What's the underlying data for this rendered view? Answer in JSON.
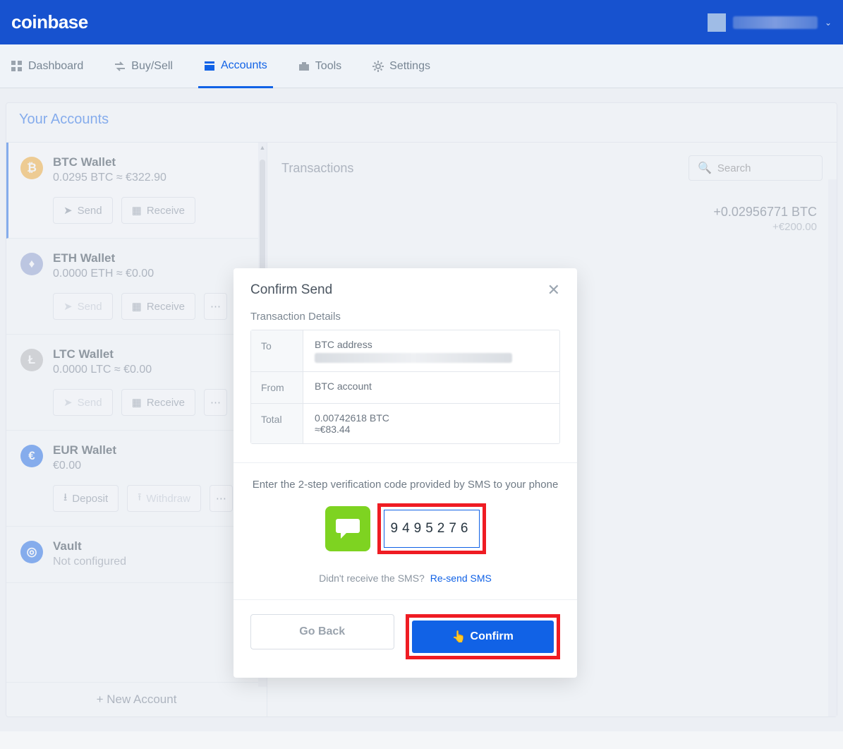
{
  "header": {
    "brand": "coinbase"
  },
  "nav": {
    "dashboard": "Dashboard",
    "buysell": "Buy/Sell",
    "accounts": "Accounts",
    "tools": "Tools",
    "settings": "Settings"
  },
  "accounts": {
    "title": "Your Accounts",
    "new_label": "+ New Account",
    "wallets": [
      {
        "name": "BTC Wallet",
        "balance": "0.0295 BTC ≈ €322.90",
        "icon": "btc"
      },
      {
        "name": "ETH Wallet",
        "balance": "0.0000 ETH ≈ €0.00",
        "icon": "eth"
      },
      {
        "name": "LTC Wallet",
        "balance": "0.0000 LTC ≈ €0.00",
        "icon": "ltc"
      },
      {
        "name": "EUR Wallet",
        "balance": "€0.00",
        "icon": "eur"
      },
      {
        "name": "Vault",
        "balance": "Not configured",
        "icon": "vault"
      }
    ],
    "btn_send": "Send",
    "btn_receive": "Receive",
    "btn_deposit": "Deposit",
    "btn_withdraw": "Withdraw",
    "btn_more": "⋯"
  },
  "transactions": {
    "title": "Transactions",
    "search_placeholder": "Search",
    "amount_main": "+0.02956771 BTC",
    "amount_sub": "+€200.00"
  },
  "modal": {
    "title": "Confirm Send",
    "details_label": "Transaction Details",
    "to_key": "To",
    "to_label": "BTC address",
    "from_key": "From",
    "from_val": "BTC account",
    "total_key": "Total",
    "total_btc": "0.00742618 BTC",
    "total_fiat": "≈€83.44",
    "verify_text": "Enter the 2-step verification code provided by SMS to your phone",
    "code_value": "9495276",
    "resend_q": "Didn't receive the SMS?",
    "resend_link": "Re-send SMS",
    "back": "Go Back",
    "confirm": "Confirm"
  }
}
